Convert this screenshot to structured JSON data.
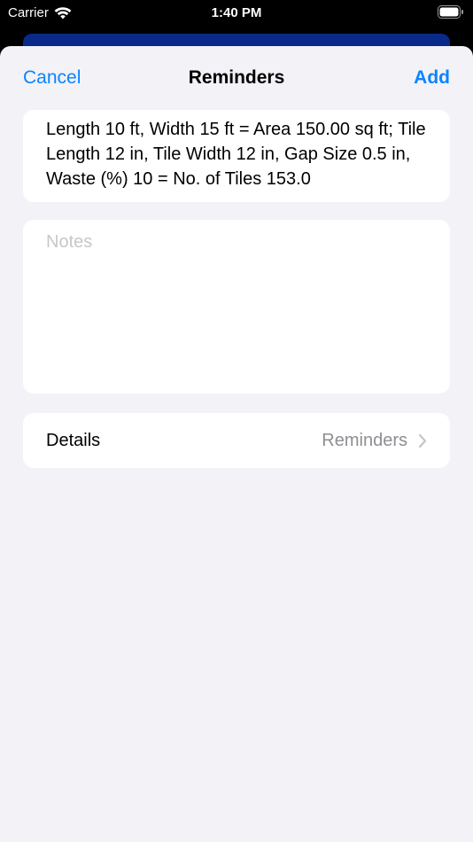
{
  "status_bar": {
    "carrier": "Carrier",
    "time": "1:40 PM"
  },
  "nav": {
    "cancel_label": "Cancel",
    "title": "Reminders",
    "add_label": "Add"
  },
  "reminder": {
    "title_text": "Length 10 ft, Width 15 ft = Area 150.00 sq ft; Tile Length 12 in, Tile Width 12 in, Gap Size 0.5 in, Waste (%) 10 = No. of Tiles 153.0"
  },
  "notes": {
    "placeholder": "Notes",
    "value": ""
  },
  "details": {
    "label": "Details",
    "value": "Reminders"
  },
  "colors": {
    "accent": "#0a84ff",
    "sheet_background": "#f2f2f7",
    "secondary_text": "#8e8e93",
    "placeholder": "#c7c7cc"
  }
}
